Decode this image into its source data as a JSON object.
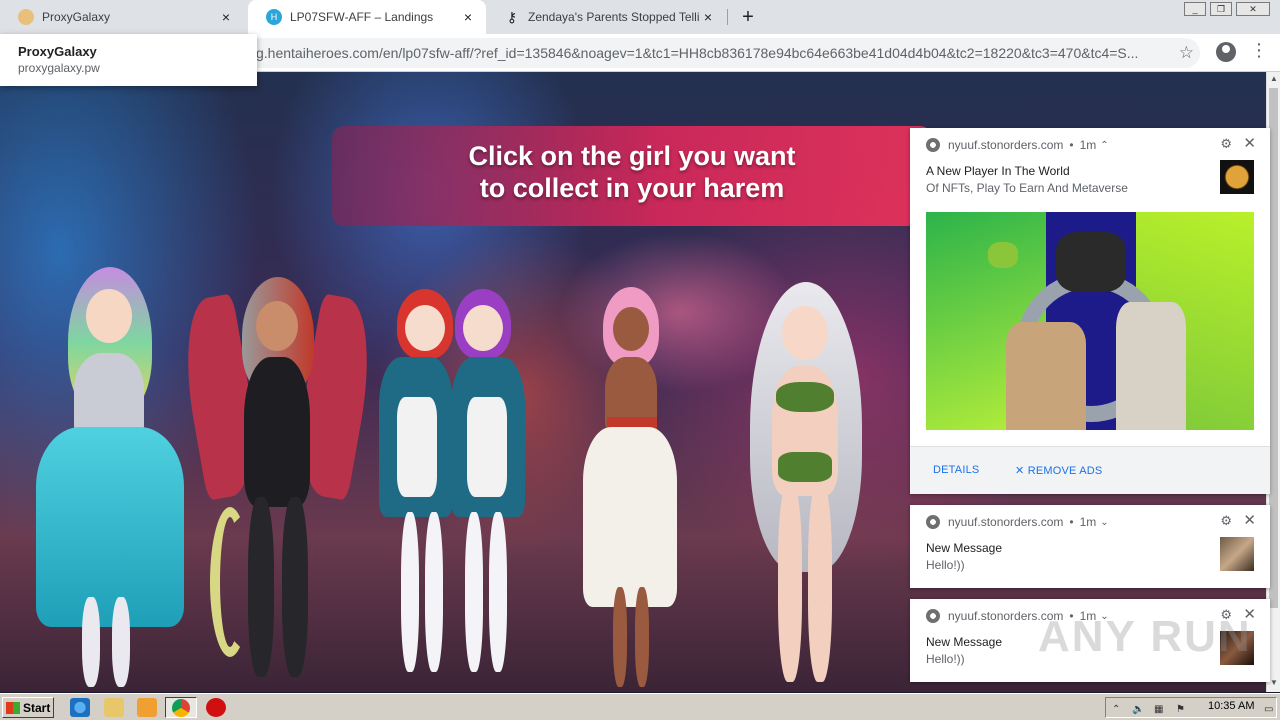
{
  "browser": {
    "tabs": [
      {
        "title": "ProxyGalaxy",
        "active": false
      },
      {
        "title": "LP07SFW-AFF – Landings",
        "active": true
      },
      {
        "title": "Zendaya's Parents Stopped Telling H",
        "active": false
      }
    ],
    "new_tab": "+",
    "url": "g.hentaiheroes.com/en/lp07sfw-aff/?ref_id=135846&noagev=1&tc1=HH8cb836178e94bc64e663be41d04d4b04&tc2=18220&tc3=470&tc4=S...",
    "site_popup": {
      "name": "ProxyGalaxy",
      "url": "proxygalaxy.pw"
    }
  },
  "page": {
    "banner_line1": "Click on the girl you want",
    "banner_line2": "to collect in your harem",
    "prev_arrow": "‹"
  },
  "notifications": [
    {
      "source": "nyuuf.stonorders.com",
      "time": "1m",
      "title": "A New Player In The World",
      "body": "Of NFTs, Play To Earn And Metaverse",
      "details_label": "DETAILS",
      "remove_label": "REMOVE ADS"
    },
    {
      "source": "nyuuf.stonorders.com",
      "time": "1m",
      "title": "New Message",
      "body": "Hello!))"
    },
    {
      "source": "nyuuf.stonorders.com",
      "time": "1m",
      "title": "New Message",
      "body": "Hello!))"
    }
  ],
  "watermark": "ANY RUN",
  "taskbar": {
    "start_label": "Start",
    "clock": "10:35 AM"
  },
  "colors": {
    "banner": "#e0285a",
    "link": "#1a73e8",
    "taskbar": "#d4d0c8"
  }
}
